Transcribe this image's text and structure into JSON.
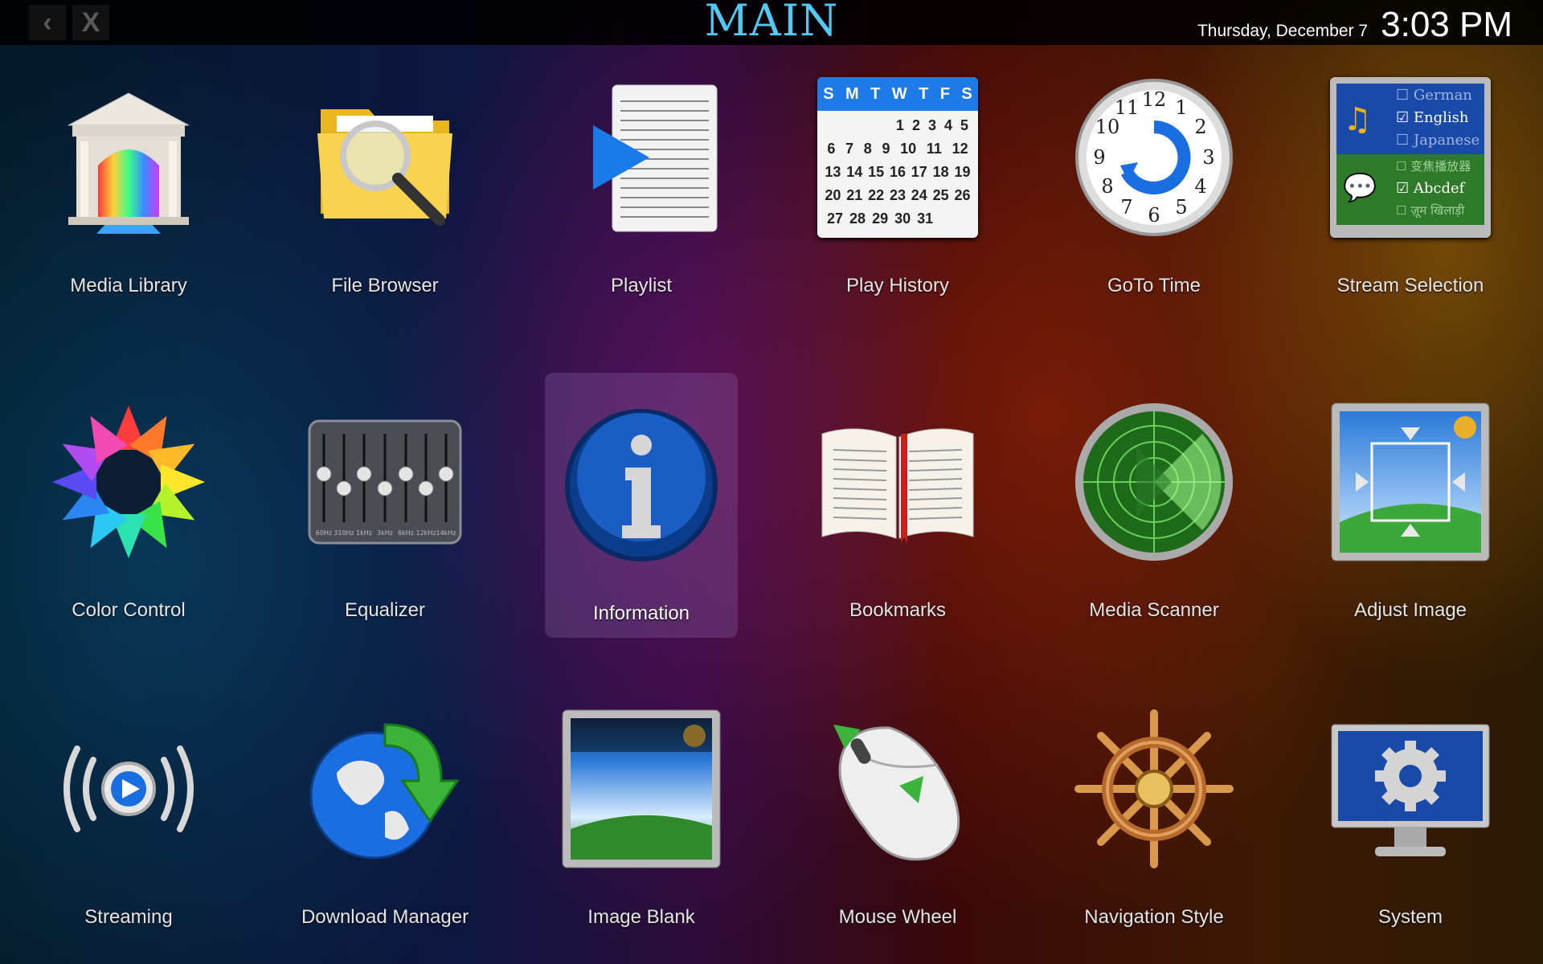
{
  "header": {
    "back_glyph": "‹",
    "close_glyph": "X",
    "title": "MAIN",
    "date": "Thursday, December 7",
    "time": "3:03 PM"
  },
  "tiles": [
    {
      "label": "Media Library",
      "icon": "media-library-icon"
    },
    {
      "label": "File Browser",
      "icon": "file-browser-icon"
    },
    {
      "label": "Playlist",
      "icon": "playlist-icon"
    },
    {
      "label": "Play History",
      "icon": "calendar-icon"
    },
    {
      "label": "GoTo Time",
      "icon": "clock-icon"
    },
    {
      "label": "Stream Selection",
      "icon": "stream-selection-icon"
    },
    {
      "label": "Color Control",
      "icon": "color-wheel-icon"
    },
    {
      "label": "Equalizer",
      "icon": "equalizer-icon"
    },
    {
      "label": "Information",
      "icon": "info-icon"
    },
    {
      "label": "Bookmarks",
      "icon": "book-icon"
    },
    {
      "label": "Media Scanner",
      "icon": "radar-icon"
    },
    {
      "label": "Adjust Image",
      "icon": "adjust-image-icon"
    },
    {
      "label": "Streaming",
      "icon": "streaming-icon"
    },
    {
      "label": "Download Manager",
      "icon": "globe-download-icon"
    },
    {
      "label": "Image Blank",
      "icon": "image-blank-icon"
    },
    {
      "label": "Mouse Wheel",
      "icon": "mouse-icon"
    },
    {
      "label": "Navigation Style",
      "icon": "ship-wheel-icon"
    },
    {
      "label": "System",
      "icon": "monitor-gear-icon"
    }
  ],
  "selected": "Information",
  "calendar": {
    "days": [
      "S",
      "M",
      "T",
      "W",
      "T",
      "F",
      "S"
    ],
    "rows": [
      [
        "",
        "",
        "",
        "1",
        "2",
        "3",
        "4",
        "5"
      ],
      [
        "6",
        "7",
        "8",
        "9",
        "10",
        "11",
        "12"
      ],
      [
        "13",
        "14",
        "15",
        "16",
        "17",
        "18",
        "19"
      ],
      [
        "20",
        "21",
        "22",
        "23",
        "24",
        "25",
        "26"
      ],
      [
        "27",
        "28",
        "29",
        "30",
        "31"
      ]
    ]
  },
  "clock_numbers": [
    "12",
    "1",
    "2",
    "3",
    "4",
    "5",
    "6",
    "7",
    "8",
    "9",
    "10",
    "11"
  ],
  "stream_langs": [
    "German",
    "English",
    "Japanese",
    "变焦播放器",
    "Abcdef",
    "ज़ूम खिलाड़ी"
  ],
  "eq_freqs": [
    "60Hz",
    "310Hz",
    "1kHz",
    "3kHz",
    "6kHz",
    "12kHz",
    "14kHz"
  ]
}
